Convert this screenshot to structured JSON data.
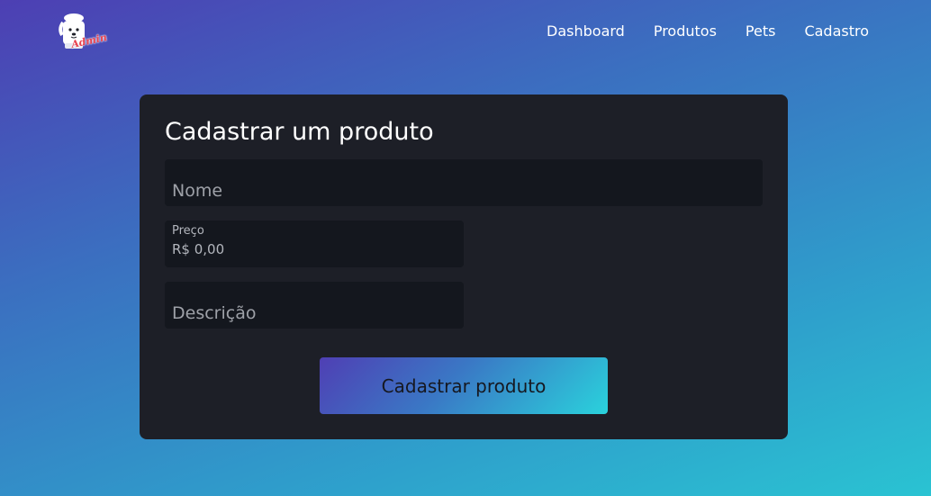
{
  "logo": {
    "icon": "dog-chef-logo-icon",
    "text": "Admin",
    "colors": {
      "accent": "#e8424f",
      "fur": "#ffffff"
    }
  },
  "nav": {
    "items": [
      {
        "label": "Dashboard"
      },
      {
        "label": "Produtos"
      },
      {
        "label": "Pets"
      },
      {
        "label": "Cadastro"
      }
    ]
  },
  "form": {
    "title": "Cadastrar um produto",
    "name_placeholder": "Nome",
    "price_label": "Preço",
    "price_value": "R$ 0,00",
    "description_placeholder": "Descrição",
    "submit_label": "Cadastrar produto"
  },
  "colors": {
    "background_gradient_start": "#4d3fb3",
    "background_gradient_end": "#2ac3d2",
    "card_background": "#1d1f27",
    "input_background": "#14171e",
    "button_gradient_start": "#4f3fb4",
    "button_gradient_end": "#2ad2dc"
  }
}
